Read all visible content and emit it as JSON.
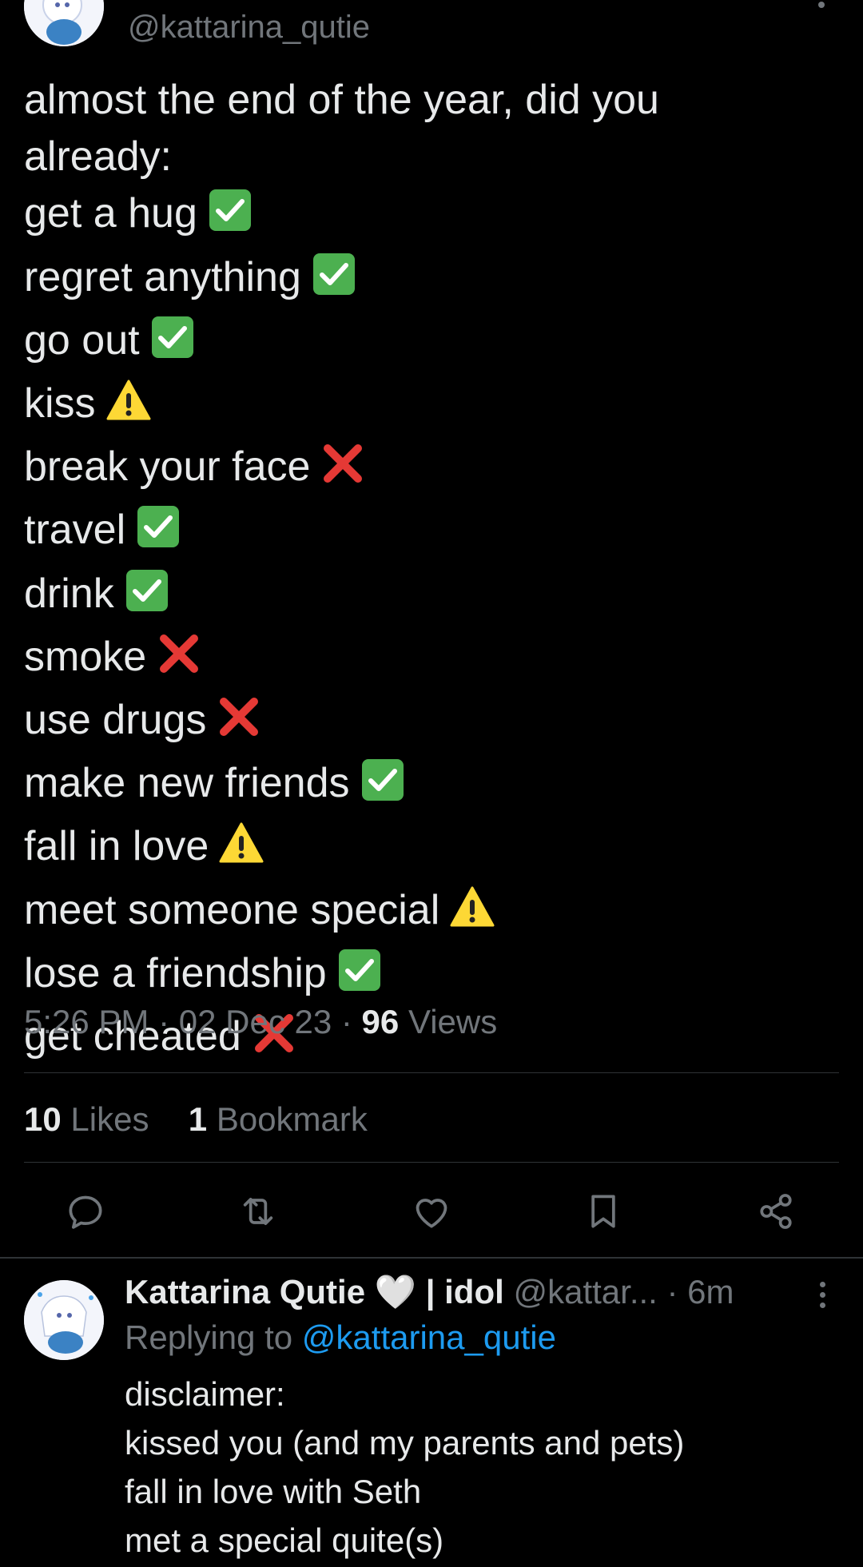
{
  "tweet": {
    "handle": "@kattarina_qutie",
    "lines": [
      {
        "text": "almost the end of the year, did you",
        "emoji": ""
      },
      {
        "text": "already:",
        "emoji": ""
      },
      {
        "text": "get a hug",
        "emoji": "check"
      },
      {
        "text": "regret anything",
        "emoji": "check"
      },
      {
        "text": "go out",
        "emoji": "check"
      },
      {
        "text": "kiss",
        "emoji": "warning"
      },
      {
        "text": "break your face",
        "emoji": "cross"
      },
      {
        "text": "travel",
        "emoji": "check"
      },
      {
        "text": "drink",
        "emoji": "check"
      },
      {
        "text": "smoke",
        "emoji": "cross"
      },
      {
        "text": "use drugs",
        "emoji": "cross"
      },
      {
        "text": "make new friends",
        "emoji": "check"
      },
      {
        "text": "fall in love",
        "emoji": "warning"
      },
      {
        "text": "meet someone special",
        "emoji": "warning"
      },
      {
        "text": "lose a friendship",
        "emoji": "check"
      },
      {
        "text": "get cheated",
        "emoji": "cross"
      }
    ],
    "time": "5:26 PM",
    "date": "02 Dec 23",
    "views_count": "96",
    "views_label": "Views",
    "likes_count": "10",
    "likes_label": "Likes",
    "bookmarks_count": "1",
    "bookmarks_label": "Bookmark"
  },
  "actions": [
    "reply-icon",
    "retweet-icon",
    "like-icon",
    "bookmark-icon",
    "share-icon"
  ],
  "reply": {
    "display_name": "Kattarina Qutie",
    "heart": "🤍",
    "suffix": "| idol",
    "handle": "@kattar...",
    "time": "· 6m",
    "replying_prefix": "Replying to",
    "replying_handle": "@kattarina_qutie",
    "lines": [
      "disclaimer:",
      "kissed you (and my parents and pets)",
      "fall in love with Seth",
      "met a special quite(s)"
    ]
  },
  "colors": {
    "background": "#000000",
    "text": "#e7e9ea",
    "secondary": "#71767b",
    "link": "#1d9bf0",
    "divider": "#2f3336",
    "check": "#4cb050",
    "cross": "#e53935",
    "warning": "#fdd835"
  }
}
